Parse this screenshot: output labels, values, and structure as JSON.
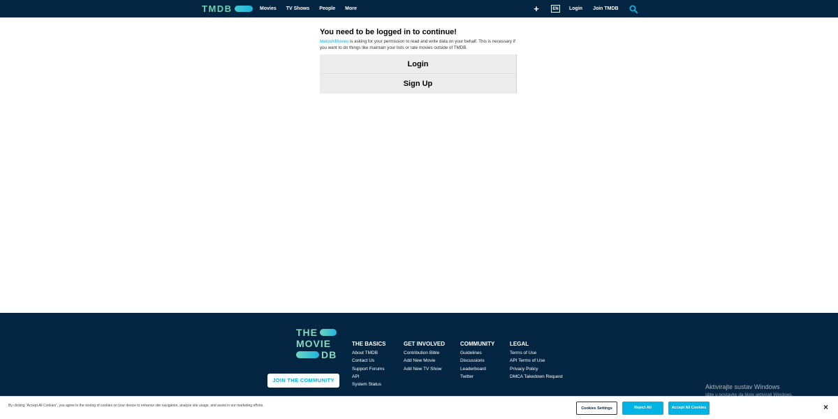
{
  "header": {
    "logo_text": "TMDB",
    "nav": [
      "Movies",
      "TV Shows",
      "People",
      "More"
    ],
    "plus_icon": "+",
    "language": "EN",
    "login": "Login",
    "join": "Join TMDB"
  },
  "main": {
    "title": "You need to be logged in to continue!",
    "app_name": "MatoshiMovies",
    "description": " is asking for your permission to read and write data on your behalf. This is necessary if you want to do things like maintain your lists or rate movies outside of TMDB.",
    "login_button": "Login",
    "signup_button": "Sign Up"
  },
  "footer": {
    "logo_line1": "THE",
    "logo_line2": "MOVIE",
    "logo_line3": "DB",
    "join_button": "JOIN THE COMMUNITY",
    "columns": [
      {
        "heading": "THE BASICS",
        "links": [
          "About TMDB",
          "Contact Us",
          "Support Forums",
          "API",
          "System Status"
        ]
      },
      {
        "heading": "GET INVOLVED",
        "links": [
          "Contribution Bible",
          "Add New Movie",
          "Add New TV Show"
        ]
      },
      {
        "heading": "COMMUNITY",
        "links": [
          "Guidelines",
          "Discussions",
          "Leaderboard",
          "Twitter"
        ]
      },
      {
        "heading": "LEGAL",
        "links": [
          "Terms of Use",
          "API Terms of Use",
          "Privacy Policy",
          "DMCA Takedown Request"
        ]
      }
    ]
  },
  "watermark": {
    "line1": "Aktivirajte sustav Windows",
    "line2": "Idite u postavke da biste aktivirali Windows."
  },
  "cookie": {
    "text": "By clicking “Accept All Cookies”, you agree to the storing of cookies on your device to enhance site navigation, analyze site usage, and assist in our marketing efforts.",
    "settings": "Cookies Settings",
    "reject": "Reject All",
    "accept": "Accept All Cookies",
    "close": "×"
  },
  "colors": {
    "header_bg": "#032541",
    "accent": "#01b4e4",
    "logo_green": "#90cea1"
  }
}
